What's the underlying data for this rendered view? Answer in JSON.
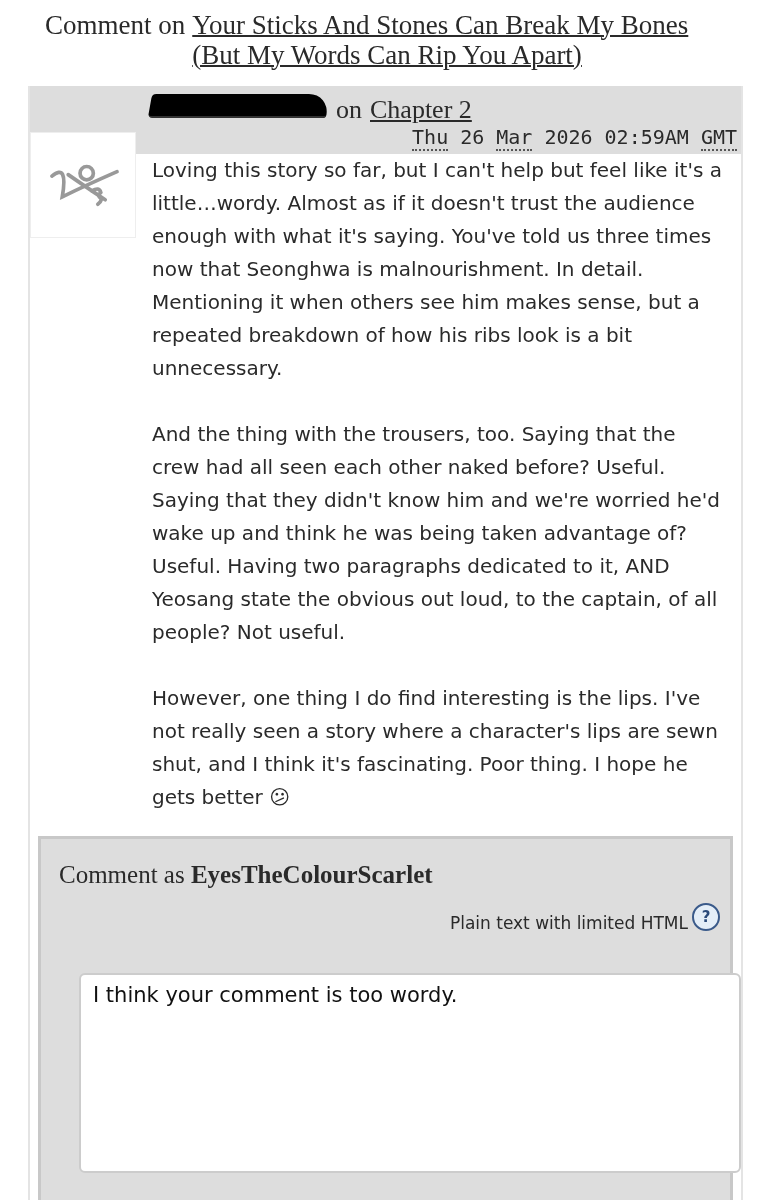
{
  "heading": {
    "prefix": "Comment on",
    "work_title": "Your Sticks And Stones Can Break My Bones (But My Words Can Rip You Apart)"
  },
  "comment": {
    "author": {
      "redacted": true
    },
    "on_word": "on",
    "chapter": "Chapter 2",
    "date_parts": [
      {
        "text": "Thu",
        "abbr": true
      },
      {
        "text": "26",
        "abbr": false
      },
      {
        "text": "Mar",
        "abbr": true
      },
      {
        "text": "2026",
        "abbr": false
      },
      {
        "text": "02:59AM",
        "abbr": false
      },
      {
        "text": "GMT",
        "abbr": true
      }
    ],
    "paragraphs": [
      "Loving this story so far, but I can't help but feel like it's a little…wordy. Almost as if it doesn't trust the audience enough with what it's saying. You've told us three times now that Seonghwa is malnourishment. In detail. Mentioning it when others see him makes sense, but a repeated breakdown of how his ribs look is a bit unnecessary.",
      "And the thing with the trousers, too. Saying that the crew had all seen each other naked before? Useful. Saying that they didn't know him and we're worried he'd wake up and think he was being taken advantage of? Useful. Having two paragraphs dedicated to it, AND Yeosang state the obvious out loud, to the captain, of all people? Not useful.",
      "However, one thing I do find interesting is the lips. I've not really seen a story where a character's lips are sewn shut, and I think it's fascinating. Poor thing. I hope he gets better 😕"
    ]
  },
  "form": {
    "prefix": "Comment as",
    "username": "EyesTheColourScarlet",
    "hint": "Plain text with limited HTML",
    "help": "?",
    "value": "I think your comment is too wordy."
  }
}
